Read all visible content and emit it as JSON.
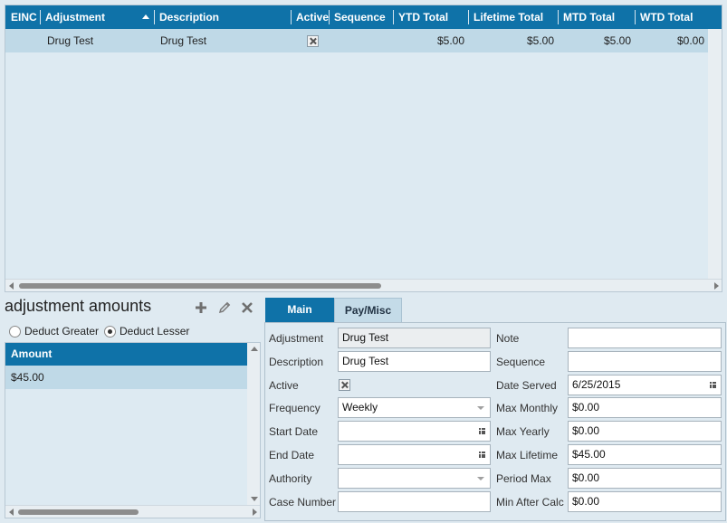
{
  "grid": {
    "columns": [
      "EINC",
      "Adjustment",
      "Description",
      "Active",
      "Sequence",
      "YTD Total",
      "Lifetime Total",
      "MTD Total",
      "WTD Total"
    ],
    "rows": [
      {
        "einc": "",
        "adjustment": "Drug Test",
        "description": "Drug Test",
        "active": true,
        "sequence": "",
        "ytd_total": "$5.00",
        "lifetime_total": "$5.00",
        "mtd_total": "$5.00",
        "wtd_total": "$0.00"
      }
    ]
  },
  "amounts": {
    "title": "adjustment amounts",
    "icons": [
      "plus-icon",
      "pencil-icon",
      "close-icon"
    ],
    "radio_deduct_greater": "Deduct Greater",
    "radio_deduct_lesser": "Deduct Lesser",
    "selected_radio": "Deduct Lesser",
    "column": "Amount",
    "rows": [
      "$45.00"
    ]
  },
  "tabs": {
    "main": "Main",
    "pay_misc": "Pay/Misc",
    "active_tab": "Main"
  },
  "form": {
    "adjustment": {
      "label": "Adjustment",
      "value": "Drug Test"
    },
    "description": {
      "label": "Description",
      "value": "Drug Test"
    },
    "active": {
      "label": "Active",
      "checked": true
    },
    "frequency": {
      "label": "Frequency",
      "value": "Weekly"
    },
    "start_date": {
      "label": "Start Date",
      "value": ""
    },
    "end_date": {
      "label": "End Date",
      "value": ""
    },
    "authority": {
      "label": "Authority",
      "value": ""
    },
    "case_number": {
      "label": "Case Number",
      "value": ""
    },
    "note": {
      "label": "Note",
      "value": ""
    },
    "sequence": {
      "label": "Sequence",
      "value": ""
    },
    "date_served": {
      "label": "Date Served",
      "value": "6/25/2015"
    },
    "max_monthly": {
      "label": "Max Monthly",
      "value": "$0.00"
    },
    "max_yearly": {
      "label": "Max Yearly",
      "value": "$0.00"
    },
    "max_lifetime": {
      "label": "Max Lifetime",
      "value": "$45.00"
    },
    "period_max": {
      "label": "Period Max",
      "value": "$0.00"
    },
    "min_after_calc": {
      "label": "Min After Calc",
      "value": "$0.00"
    }
  },
  "colors": {
    "header_blue": "#0f72a8",
    "selected_row": "#bfd9e7",
    "panel_bg": "#ddeaf2"
  }
}
